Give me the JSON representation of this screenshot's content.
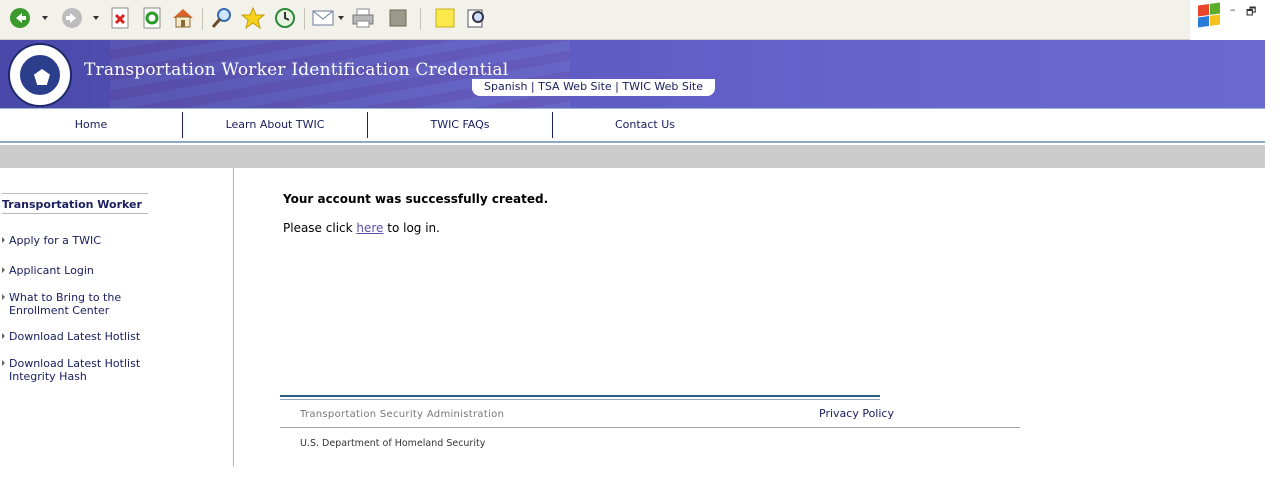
{
  "toolbar": {
    "icons": [
      "back-icon",
      "forward-icon",
      "stop-icon",
      "refresh-icon",
      "home-icon",
      "search-icon",
      "favorites-icon",
      "history-icon",
      "mail-icon",
      "print-icon",
      "edit-icon",
      "notes-icon",
      "research-icon"
    ]
  },
  "window": {
    "minimize": "–",
    "restore": "🗗"
  },
  "header": {
    "title": "Transportation Worker Identification Credential",
    "top_links": [
      "Spanish",
      "TSA Web Site",
      "TWIC Web Site"
    ],
    "separator": " | "
  },
  "nav": {
    "items": [
      "Home",
      "Learn About TWIC",
      "TWIC FAQs",
      "Contact Us"
    ]
  },
  "sidebar": {
    "heading": "Transportation Worker",
    "items": [
      "Apply for a TWIC",
      "Applicant Login",
      "What to Bring to the Enrollment Center",
      "Download Latest Hotlist",
      "Download Latest Hotlist Integrity Hash"
    ]
  },
  "main": {
    "heading": "Your account was successfully created.",
    "line_prefix": "Please click ",
    "line_link": "here",
    "line_suffix": " to log in."
  },
  "footer": {
    "agency": "Transportation Security Administration",
    "privacy": "Privacy Policy",
    "department": "U.S. Department of Homeland Security"
  },
  "colors": {
    "header_bg": "#6765cc",
    "nav_text": "#1b2060",
    "link": "#5a4fb0",
    "gray_bar": "#cccccc"
  }
}
